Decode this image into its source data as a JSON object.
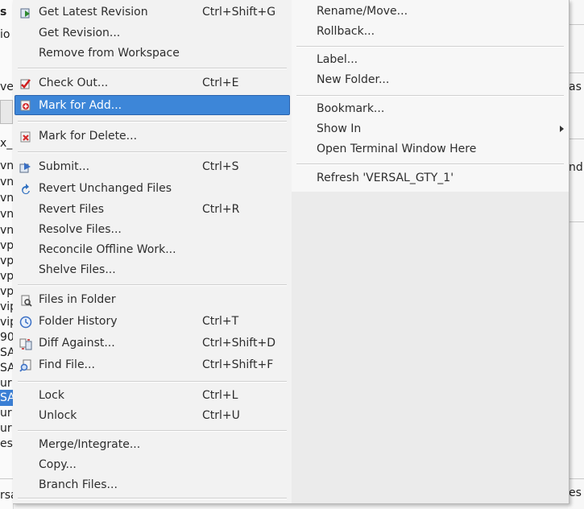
{
  "background": {
    "left_fragments": [
      "s",
      "io",
      "",
      "ver",
      "",
      "",
      "x_",
      "vn",
      "vn",
      "vn",
      "vn",
      "vn",
      "vp",
      "vp",
      "vp",
      "vp",
      "vip",
      "vip",
      "90",
      "SA",
      "SA",
      "ur",
      "ur",
      "es",
      "",
      "rsa"
    ],
    "right_fragments": [
      "as",
      "nd",
      "es"
    ]
  },
  "menu": {
    "left_items": [
      {
        "label": "Get Latest Revision",
        "shortcut": "Ctrl+Shift+G",
        "icon": "get-latest-icon"
      },
      {
        "label": "Get Revision...",
        "shortcut": ""
      },
      {
        "label": "Remove from Workspace",
        "shortcut": ""
      },
      {
        "label": "Check Out...",
        "shortcut": "Ctrl+E",
        "icon": "checkout-icon"
      },
      {
        "label": "Mark for Add...",
        "shortcut": "",
        "icon": "mark-add-icon",
        "highlighted": true
      },
      {
        "label": "Mark for Delete...",
        "shortcut": "",
        "icon": "mark-delete-icon"
      },
      {
        "label": "Submit...",
        "shortcut": "Ctrl+S",
        "icon": "submit-icon"
      },
      {
        "label": "Revert Unchanged Files",
        "shortcut": "",
        "icon": "revert-unchanged-icon"
      },
      {
        "label": "Revert Files",
        "shortcut": "Ctrl+R"
      },
      {
        "label": "Resolve Files...",
        "shortcut": ""
      },
      {
        "label": "Reconcile Offline Work...",
        "shortcut": ""
      },
      {
        "label": "Shelve Files...",
        "shortcut": ""
      },
      {
        "label": "Files in Folder",
        "shortcut": "",
        "icon": "files-in-folder-icon"
      },
      {
        "label": "Folder History",
        "shortcut": "Ctrl+T",
        "icon": "history-icon"
      },
      {
        "label": "Diff Against...",
        "shortcut": "Ctrl+Shift+D",
        "icon": "diff-icon"
      },
      {
        "label": "Find File...",
        "shortcut": "Ctrl+Shift+F",
        "icon": "find-file-icon"
      },
      {
        "label": "Lock",
        "shortcut": "Ctrl+L"
      },
      {
        "label": "Unlock",
        "shortcut": "Ctrl+U"
      },
      {
        "label": "Merge/Integrate...",
        "shortcut": ""
      },
      {
        "label": "Copy...",
        "shortcut": ""
      },
      {
        "label": "Branch Files...",
        "shortcut": ""
      }
    ],
    "right_items": [
      {
        "label": "Rename/Move..."
      },
      {
        "label": "Rollback..."
      },
      {
        "label": "Label..."
      },
      {
        "label": "New Folder..."
      },
      {
        "label": "Bookmark..."
      },
      {
        "label": "Show In",
        "submenu": true
      },
      {
        "label": "Open Terminal Window Here"
      },
      {
        "label": "Refresh 'VERSAL_GTY_1'"
      }
    ]
  },
  "colors": {
    "highlight": "#3d86d8",
    "menu_bg": "#f2f2f2"
  }
}
